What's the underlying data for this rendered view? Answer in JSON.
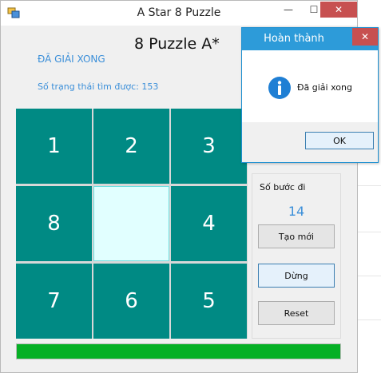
{
  "window": {
    "title": "A Star 8 Puzzle",
    "minimize": "—",
    "maximize": "☐",
    "close": "✕"
  },
  "main": {
    "heading": "8 Puzzle A*",
    "status": "ĐÃ GIẢI XONG",
    "states_found": "Số trạng thái tìm được: 153"
  },
  "board": {
    "tiles": [
      "1",
      "2",
      "3",
      "8",
      "",
      "4",
      "7",
      "6",
      "5"
    ]
  },
  "controls": {
    "steps_label": "Số bước đi",
    "steps_value": "14",
    "new_button": "Tạo mới",
    "stop_button": "Dừng",
    "reset_button": "Reset"
  },
  "progress": {
    "value": 1.0
  },
  "dialog": {
    "title": "Hoàn thành",
    "close": "✕",
    "message": "Đã giải xong",
    "ok_button": "OK",
    "icon": "info-icon"
  },
  "colors": {
    "tile": "#008a84",
    "blank": "#e1ffff",
    "accent_text": "#3b8fd9",
    "progress": "#06b025",
    "dialog_title": "#2d9bd9",
    "close": "#c75050"
  }
}
